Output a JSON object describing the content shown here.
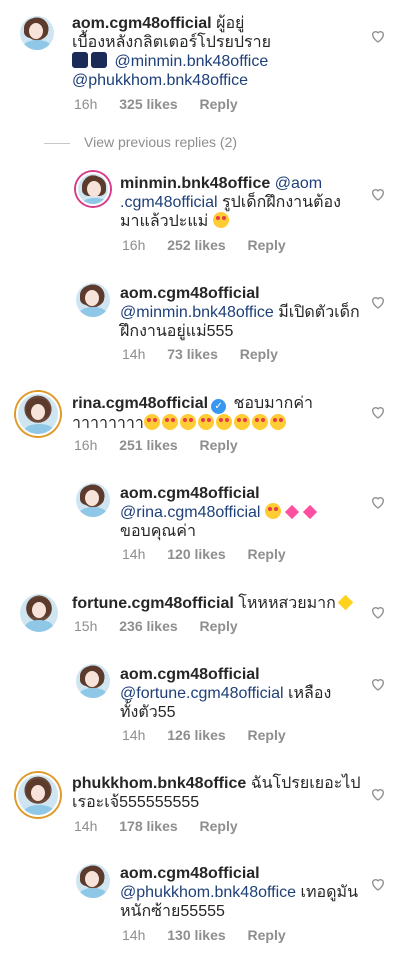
{
  "view_previous": "View previous replies (2)",
  "reply_label": "Reply",
  "comments": [
    {
      "user": "aom.cgm48official",
      "l1": "ผู้อยู่",
      "l2": "เบื้องหลังกลิตเตอร์โปรยปราย",
      "l3m": "@minmin.bnk48office",
      "l4m": "@phukkhom.bnk48office",
      "time": "16h",
      "likes": "325 likes"
    },
    {
      "user": "minmin.bnk48office",
      "l1m": "@aom",
      "l2m": ".cgm48official",
      "l2": " รูปเด็กฝึกงานต้อง",
      "l3": "มาแล้วปะแม่",
      "time": "16h",
      "likes": "252 likes"
    },
    {
      "user": "aom.cgm48official",
      "l2m": "@minmin.bnk48office",
      "l2": " มีเปิดตัวเด็ก",
      "l3": "ฝึกงานอยู่แม่555",
      "time": "14h",
      "likes": "73 likes"
    },
    {
      "user": "rina.cgm48official",
      "l1": " ชอบมากค่า",
      "l2": "าาาาาาาา",
      "time": "16h",
      "likes": "251 likes"
    },
    {
      "user": "aom.cgm48official",
      "l2m": "@rina.cgm48official",
      "l3": "ขอบคุณค่า",
      "time": "14h",
      "likes": "120 likes"
    },
    {
      "user": "fortune.cgm48official",
      "l1": " โหหหสวยมาก",
      "time": "15h",
      "likes": "236 likes"
    },
    {
      "user": "aom.cgm48official",
      "l2m": "@fortune.cgm48official",
      "l2": " เหลือง",
      "l3": "ทั้งตัว55",
      "time": "14h",
      "likes": "126 likes"
    },
    {
      "user": "phukkhom.bnk48office",
      "l1": " ฉันโปรยเยอะไป",
      "l2": "เรอะเจ้555555555",
      "time": "14h",
      "likes": "178 likes"
    },
    {
      "user": "aom.cgm48official",
      "l2m": "@phukkhom.bnk48office",
      "l2": " เทอดูมัน",
      "l3": "หนักซ้าย55555",
      "time": "14h",
      "likes": "130 likes"
    }
  ]
}
